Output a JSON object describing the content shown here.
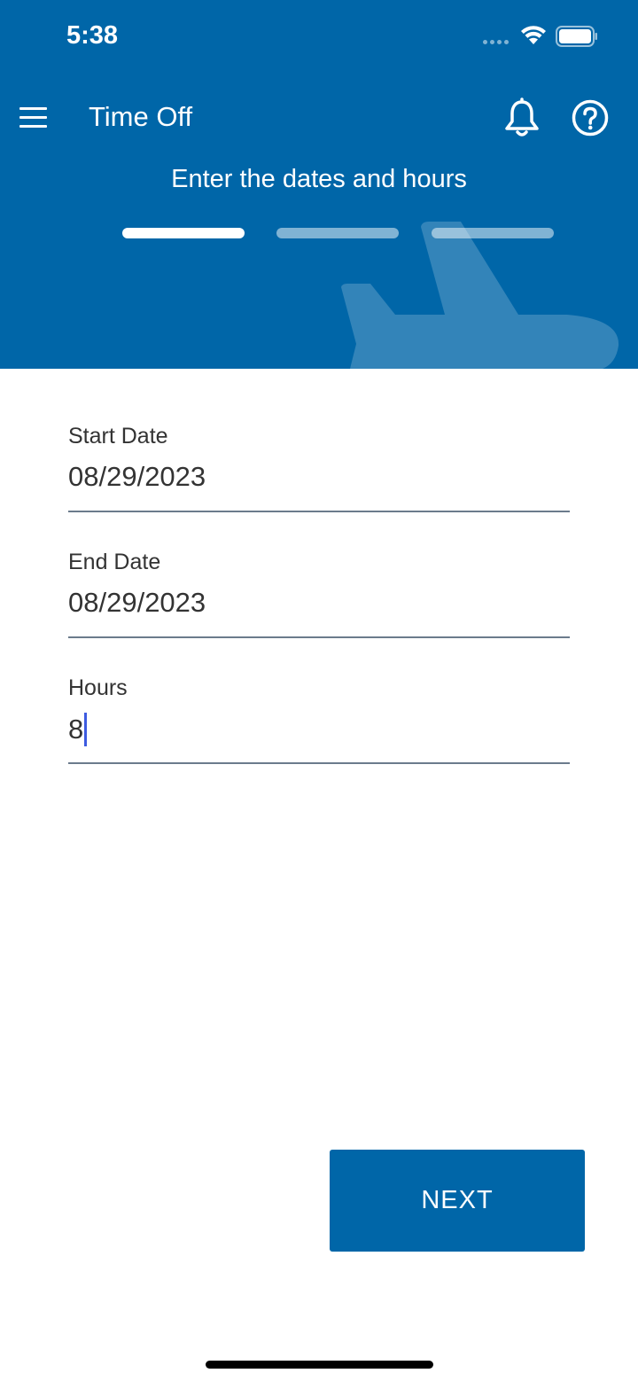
{
  "status_bar": {
    "time": "5:38"
  },
  "header": {
    "title": "Time Off",
    "step_title": "Enter the dates and hours",
    "steps": [
      {
        "state": "active"
      },
      {
        "state": "inactive"
      },
      {
        "state": "inactive"
      }
    ],
    "icons": {
      "menu": "hamburger-menu-icon",
      "notifications": "bell-icon",
      "help": "help-circle-icon",
      "decoration": "airplane-icon"
    }
  },
  "form": {
    "start_date": {
      "label": "Start Date",
      "value": "08/29/2023"
    },
    "end_date": {
      "label": "End Date",
      "value": "08/29/2023"
    },
    "hours": {
      "label": "Hours",
      "value": "8"
    }
  },
  "actions": {
    "next_label": "NEXT"
  },
  "colors": {
    "primary": "#0066A8",
    "text": "#333333",
    "caret": "#3d5be0",
    "divider": "#6b7b8c"
  }
}
